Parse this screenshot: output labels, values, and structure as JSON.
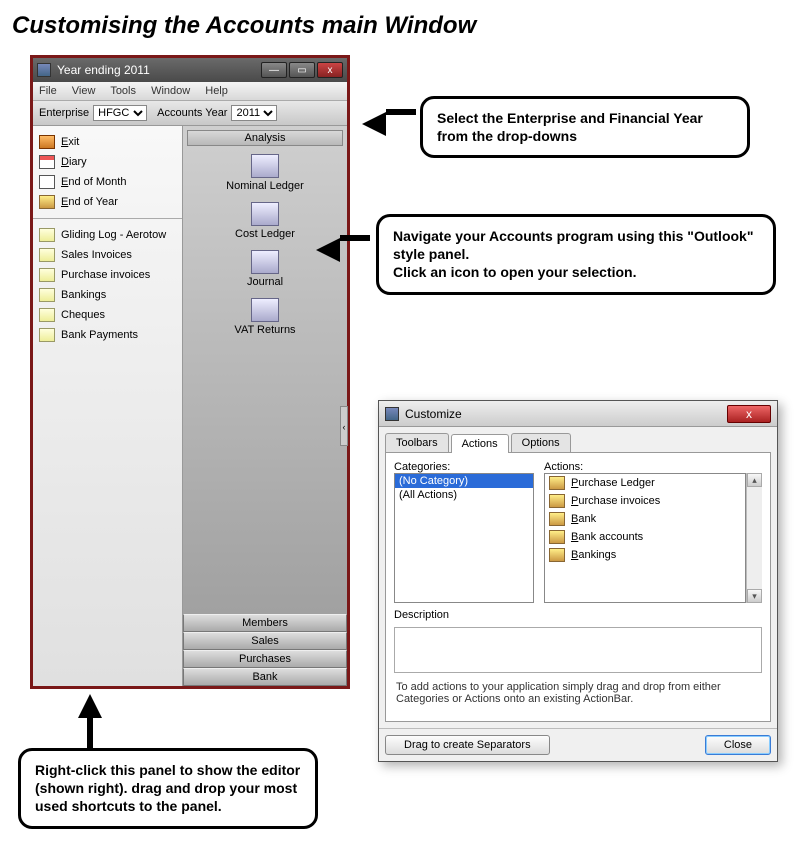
{
  "heading": "Customising the Accounts main Window",
  "main_window": {
    "title": "Year ending 2011",
    "menubar": [
      "File",
      "View",
      "Tools",
      "Window",
      "Help"
    ],
    "toolbar": {
      "enterprise_label": "Enterprise",
      "enterprise_value": "HFGC",
      "year_label": "Accounts Year",
      "year_value": "2011"
    },
    "nav_top": [
      {
        "label": "Exit",
        "u": "E",
        "rest": "xit"
      },
      {
        "label": "Diary",
        "u": "D",
        "rest": "iary"
      },
      {
        "label": "End of Month",
        "u": "E",
        "rest": "nd of Month"
      },
      {
        "label": "End of Year",
        "u": "E",
        "rest": "nd of Year"
      }
    ],
    "nav_bottom": [
      "Gliding Log - Aerotow",
      "Sales Invoices",
      "Purchase invoices",
      "Bankings",
      "Cheques",
      "Bank Payments"
    ],
    "analysis_header": "Analysis",
    "analysis_items": [
      "Nominal Ledger",
      "Cost Ledger",
      "Journal",
      "VAT Returns"
    ],
    "stack_buttons": [
      "Members",
      "Sales",
      "Purchases",
      "Bank"
    ]
  },
  "callouts": {
    "c1": "Select the Enterprise and Financial Year from the drop-downs",
    "c2": "Navigate your Accounts program using this \"Outlook\" style panel.\nClick an icon to open your selection.",
    "c3": "Right-click this panel to show the editor (shown right). drag and drop your most used shortcuts to the panel."
  },
  "dialog": {
    "title": "Customize",
    "tabs": [
      "Toolbars",
      "Actions",
      "Options"
    ],
    "active_tab": "Actions",
    "categories_label": "Categories:",
    "categories": [
      "(No Category)",
      "(All Actions)"
    ],
    "actions_label": "Actions:",
    "actions": [
      "Purchase Ledger",
      "Purchase invoices",
      "Bank",
      "Bank accounts",
      "Bankings"
    ],
    "description_label": "Description",
    "hint": "To add actions to your application simply drag and drop from either Categories or Actions onto an existing ActionBar.",
    "separator_btn": "Drag to create Separators",
    "close_btn": "Close"
  }
}
